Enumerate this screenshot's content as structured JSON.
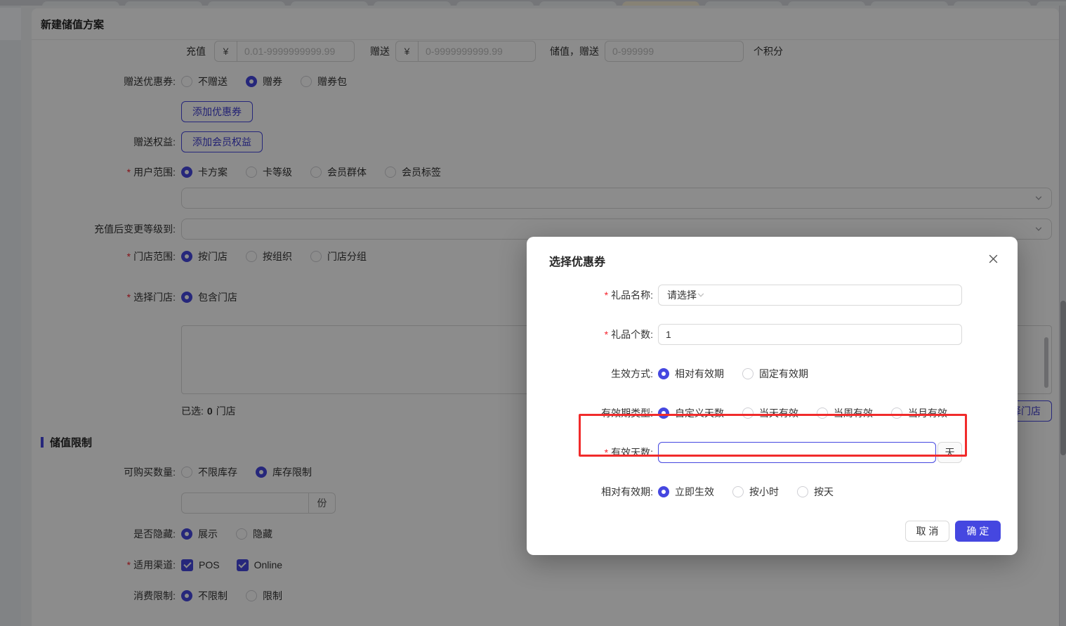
{
  "colors": {
    "primary": "#4547e0",
    "danger": "#f12b2b",
    "asterisk": "#f5222d"
  },
  "tabstrip": {
    "tab_count": 13,
    "active_index": 7
  },
  "page": {
    "title": "新建储值方案",
    "recharge_row": {
      "recharge_label": "充值",
      "currency": "¥",
      "recharge_placeholder": "0.01-9999999999.99",
      "gift_label": "赠送",
      "gift_placeholder": "0-9999999999.99",
      "stored_gift_label": "储值，赠送",
      "points_placeholder": "0-999999",
      "points_suffix": "个积分"
    },
    "coupon": {
      "label": "赠送优惠券:",
      "options": [
        "不赠送",
        "赠券",
        "赠券包"
      ],
      "selected": "赠券"
    },
    "add_coupon_button": "添加优惠券",
    "benefit": {
      "label": "赠送权益:",
      "button": "添加会员权益"
    },
    "user_scope": {
      "label": "用户范围:",
      "required": true,
      "options": [
        "卡方案",
        "卡等级",
        "会员群体",
        "会员标签"
      ],
      "selected": "卡方案"
    },
    "level_change": {
      "label": "充值后变更等级到:"
    },
    "store_scope": {
      "label": "门店范围:",
      "required": true,
      "options": [
        "按门店",
        "按组织",
        "门店分组"
      ],
      "selected": "按门店"
    },
    "store_select": {
      "label": "选择门店:",
      "required": true,
      "options": [
        "包含门店"
      ],
      "selected": "包含门店"
    },
    "selected_stores": {
      "label": "已选:",
      "count": "0",
      "unit": "门店"
    },
    "choose_store_button": "选择门店",
    "limit_section_title": "储值限制",
    "quantity": {
      "label": "可购买数量:",
      "options": [
        "不限库存",
        "库存限制"
      ],
      "selected": "库存限制",
      "unit": "份"
    },
    "visibility": {
      "label": "是否隐藏:",
      "options": [
        "展示",
        "隐藏"
      ],
      "selected": "展示"
    },
    "channels": {
      "label": "适用渠道:",
      "required": true,
      "options": [
        "POS",
        "Online"
      ],
      "checked": [
        "POS",
        "Online"
      ]
    },
    "consume_limit": {
      "label": "消费限制:",
      "options": [
        "不限制",
        "限制"
      ],
      "selected": "不限制"
    }
  },
  "modal": {
    "title": "选择优惠券",
    "gift_name": {
      "label": "礼品名称:",
      "required": true,
      "placeholder": "请选择"
    },
    "gift_count": {
      "label": "礼品个数:",
      "required": true,
      "value": "1"
    },
    "effect_mode": {
      "label": "生效方式:",
      "options": [
        "相对有效期",
        "固定有效期"
      ],
      "selected": "相对有效期"
    },
    "validity_type": {
      "label": "有效期类型:",
      "options": [
        "自定义天数",
        "当天有效",
        "当周有效",
        "当月有效"
      ],
      "selected": "自定义天数"
    },
    "valid_days": {
      "label": "有效天数:",
      "required": true,
      "value": "",
      "suffix": "天"
    },
    "relative_validity": {
      "label": "相对有效期:",
      "options": [
        "立即生效",
        "按小时",
        "按天"
      ],
      "selected": "立即生效"
    },
    "cancel_button": "取 消",
    "confirm_button": "确 定"
  }
}
